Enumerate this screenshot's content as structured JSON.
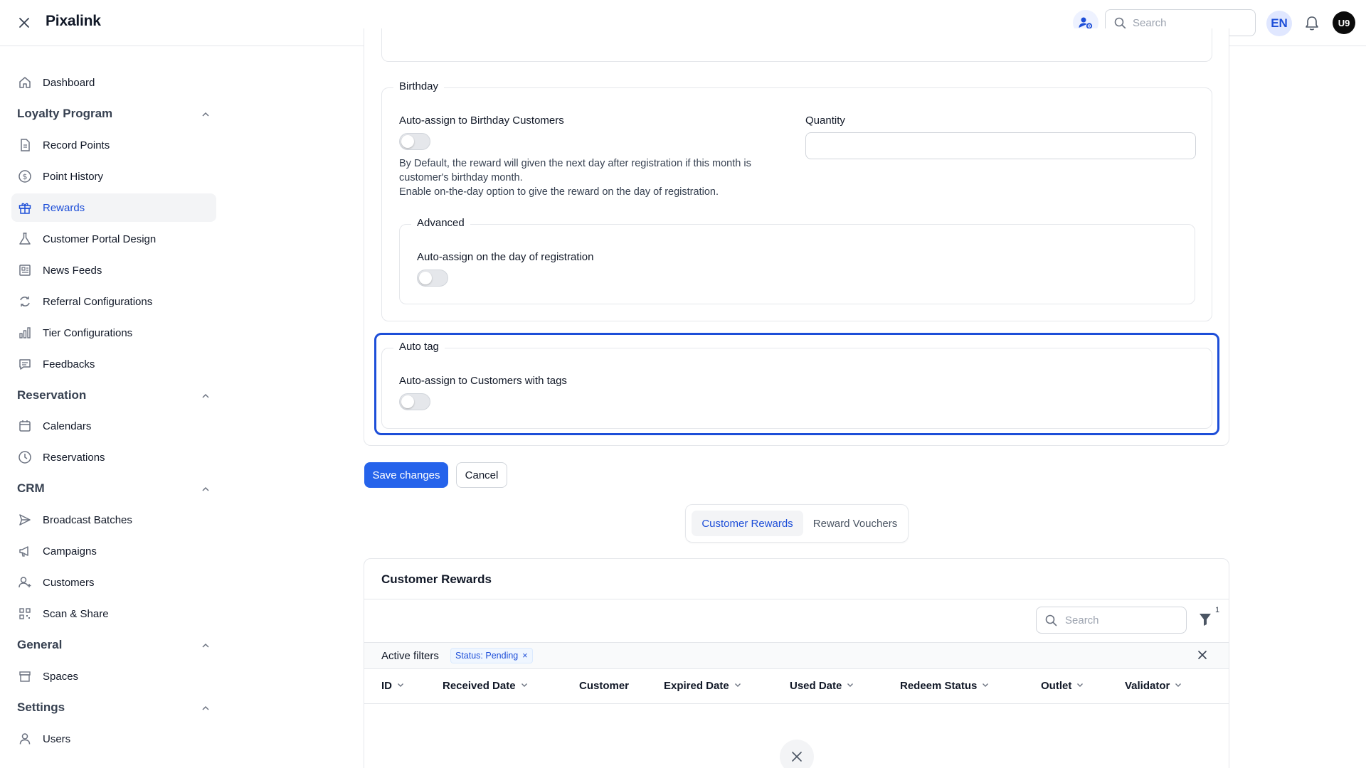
{
  "header": {
    "brand": "Pixalink",
    "search_placeholder": "Search",
    "language": "EN",
    "avatar_initials": "U9"
  },
  "sidebar": {
    "top_items": [
      {
        "label": "Dashboard",
        "icon": "home-icon"
      }
    ],
    "sections": [
      {
        "title": "Loyalty Program",
        "items": [
          {
            "label": "Record Points",
            "icon": "document-icon"
          },
          {
            "label": "Point History",
            "icon": "dollar-circle-icon"
          },
          {
            "label": "Rewards",
            "icon": "gift-icon",
            "active": true
          },
          {
            "label": "Customer Portal Design",
            "icon": "flask-icon"
          },
          {
            "label": "News Feeds",
            "icon": "newspaper-icon"
          },
          {
            "label": "Referral Configurations",
            "icon": "refresh-icon"
          },
          {
            "label": "Tier Configurations",
            "icon": "bar-chart-icon"
          },
          {
            "label": "Feedbacks",
            "icon": "chat-icon"
          }
        ]
      },
      {
        "title": "Reservation",
        "items": [
          {
            "label": "Calendars",
            "icon": "calendar-icon"
          },
          {
            "label": "Reservations",
            "icon": "clock-icon"
          }
        ]
      },
      {
        "title": "CRM",
        "items": [
          {
            "label": "Broadcast Batches",
            "icon": "send-icon"
          },
          {
            "label": "Campaigns",
            "icon": "megaphone-icon"
          },
          {
            "label": "Customers",
            "icon": "user-plus-icon"
          },
          {
            "label": "Scan & Share",
            "icon": "qr-code-icon"
          }
        ]
      },
      {
        "title": "General",
        "items": [
          {
            "label": "Spaces",
            "icon": "archive-icon"
          }
        ]
      },
      {
        "title": "Settings",
        "items": [
          {
            "label": "Users",
            "icon": "user-icon"
          }
        ]
      }
    ]
  },
  "birthday": {
    "legend": "Birthday",
    "auto_assign_label": "Auto-assign to Birthday Customers",
    "auto_assign_enabled": false,
    "help_line1": "By Default, the reward will given the next day after registration if this month is",
    "help_line2": "customer's birthday month.",
    "help_line3": "Enable on-the-day option to give the reward on the day of registration.",
    "quantity_label": "Quantity",
    "quantity_value": "",
    "advanced": {
      "legend": "Advanced",
      "on_day_label": "Auto-assign on the day of registration",
      "on_day_enabled": false
    }
  },
  "auto_tag": {
    "legend": "Auto tag",
    "label": "Auto-assign to Customers with tags",
    "enabled": false
  },
  "actions": {
    "save": "Save changes",
    "cancel": "Cancel"
  },
  "tabs": {
    "customer_rewards": "Customer Rewards",
    "reward_vouchers": "Reward Vouchers",
    "active": "customer_rewards"
  },
  "table": {
    "title": "Customer Rewards",
    "search_placeholder": "Search",
    "filter_count": "1",
    "active_filters_label": "Active filters",
    "filter_chip": "Status: Pending",
    "chip_remove": "×",
    "columns": [
      "ID",
      "Received Date",
      "Customer",
      "Expired Date",
      "Used Date",
      "Redeem Status",
      "Outlet",
      "Validator"
    ]
  },
  "colors": {
    "primary": "#2563eb",
    "focus_ring": "#1d4ed8",
    "active_nav": "#1d4ed8"
  }
}
